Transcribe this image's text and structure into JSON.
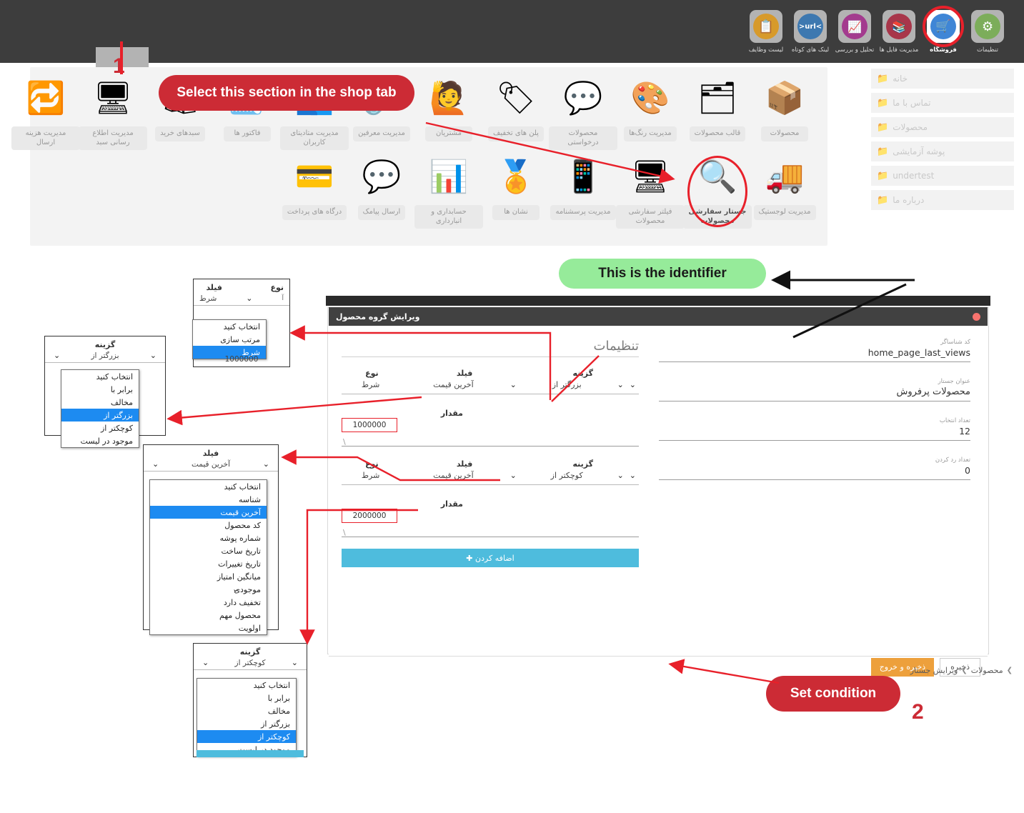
{
  "topbar": {
    "icons": [
      {
        "label": "تنظیمات",
        "name": "settings",
        "glyph": "⚙",
        "color": "#7cad5a",
        "active": false
      },
      {
        "label": "فروشگاه",
        "name": "shop",
        "glyph": "🛒",
        "color": "#3f86d6",
        "active": true,
        "highlighted": true
      },
      {
        "label": "مدیریت فایل ها",
        "name": "file-manager",
        "glyph": "📚",
        "color": "#a8364a",
        "active": false
      },
      {
        "label": "تحلیل و بررسی",
        "name": "analytics",
        "glyph": "📈",
        "color": "#a33b8e",
        "active": false
      },
      {
        "label": "لینک های کوتاه",
        "name": "short-links",
        "glyph": "url",
        "color": "#3d78b0",
        "active": false
      },
      {
        "label": "لیست وظایف",
        "name": "task-list",
        "glyph": "📋",
        "color": "#d79a2b",
        "active": false
      }
    ]
  },
  "icon_panel": {
    "items": [
      {
        "label": "محصولات",
        "art": "📦",
        "row": 1,
        "col": 1
      },
      {
        "label": "قالب محصولات",
        "art": "🗂",
        "row": 1,
        "col": 2
      },
      {
        "label": "مدیریت رنگ‌ها",
        "art": "🎨",
        "row": 1,
        "col": 3
      },
      {
        "label": "محصولات درخواستی",
        "art": "💬",
        "row": 1,
        "col": 4
      },
      {
        "label": "پلن های تخفیف",
        "art": "🏷",
        "row": 1,
        "col": 5
      },
      {
        "label": "مشتریان",
        "art": "🙋",
        "row": 1,
        "col": 6
      },
      {
        "label": "مدیریت معرفین",
        "art": "🔗",
        "row": 1,
        "col": 7
      },
      {
        "label": "مدیریت متادیتای کاربران",
        "art": "👥",
        "row": 1,
        "col": 8
      },
      {
        "label": "فاکتور ها",
        "art": "🧾",
        "row": 1,
        "col": 9
      },
      {
        "label": "سبدهای خرید",
        "art": "🛍",
        "row": 1,
        "col": 10
      },
      {
        "label": "مدیریت اطلاع رسانی سبد",
        "art": "🖥",
        "row": 1,
        "col": 11
      },
      {
        "label": "مدیریت هزینه ارسال",
        "art": "🔁",
        "row": 1,
        "col": 12
      },
      {
        "label": "مدیریت لوجستیک",
        "art": "🚚",
        "row": 2,
        "col": 1
      },
      {
        "label": "جستار سفارشی محصولات",
        "art": "🔍",
        "row": 2,
        "col": 2,
        "selected": true
      },
      {
        "label": "فیلتر سفارشی محصولات",
        "art": "🖥",
        "row": 2,
        "col": 3
      },
      {
        "label": "مدیریت پرسشنامه",
        "art": "📱",
        "row": 2,
        "col": 4
      },
      {
        "label": "نشان ها",
        "art": "🏅",
        "row": 2,
        "col": 5
      },
      {
        "label": "حسابداری و انبارداری",
        "art": "📊",
        "row": 2,
        "col": 6
      },
      {
        "label": "ارسال پیامک",
        "art": "💬",
        "row": 2,
        "col": 7
      },
      {
        "label": "درگاه های پرداخت",
        "art": "💳",
        "row": 2,
        "col": 8
      }
    ]
  },
  "folder_list": {
    "items": [
      {
        "label": "خانه"
      },
      {
        "label": "تماس با ما"
      },
      {
        "label": "محصولات"
      },
      {
        "label": "پوشه آزمایشی"
      },
      {
        "label": "undertest"
      },
      {
        "label": "درباره ما"
      }
    ]
  },
  "callouts": {
    "step1_banner": "Select this section in the shop tab",
    "step1_number": "1",
    "identifier_banner": "This is the identifier",
    "step2_banner": "Set condition",
    "step2_number": "2"
  },
  "window": {
    "title": "ویرایش گروه محصول",
    "fields": [
      {
        "label": "کد شناساگر",
        "value": "home_page_last_views",
        "ltr": true
      },
      {
        "label": "عنوان جستار",
        "value": "محصولات پرفروش",
        "ltr": false
      },
      {
        "label": "تعداد انتخاب",
        "value": "12",
        "ltr": true
      },
      {
        "label": "تعداد رد کردن",
        "value": "0",
        "ltr": true
      }
    ],
    "settings_title": "تنظیمات",
    "headers": {
      "type": "نوع",
      "field": "فیلد",
      "option": "گزینه",
      "value": "مقدار"
    },
    "conditions": [
      {
        "type": "شرط",
        "field": "آخرین قیمت",
        "option": "بزرگتر از",
        "value": "1000000"
      },
      {
        "type": "شرط",
        "field": "آخرین قیمت",
        "option": "کوچکتر از",
        "value": "2000000"
      }
    ],
    "add_button": "اضافه کردن ✚",
    "save_button": "ذخیره",
    "save_exit_button": "ذخیره و خروج"
  },
  "breadcrumb": {
    "items": [
      "محصولات",
      "ویرایش جستار"
    ],
    "separator": "❯"
  },
  "zoom_callouts": {
    "type_dropdown": {
      "header_type": "نوع",
      "header_field": "فیلد",
      "selected": "شرط",
      "peek": "آ",
      "options": [
        "انتخاب کنید",
        "مرتب سازی",
        "شرط"
      ],
      "selected_index": 2,
      "extra_value": "1000000"
    },
    "option_dropdown_top": {
      "header": "گزینه",
      "selected": "بزرگتر از",
      "options": [
        "انتخاب کنید",
        "برابر با",
        "مخالف",
        "بزرگتر از",
        "کوچکتر از",
        "موجود در لیست"
      ],
      "selected_index": 3
    },
    "field_dropdown": {
      "header": "فیلد",
      "selected": "آخرین قیمت",
      "options": [
        "انتخاب کنید",
        "شناسه",
        "آخرین قیمت",
        "کد محصول",
        "شماره پوشه",
        "تاریخ ساخت",
        "تاریخ تغییرات",
        "میانگین امتیاز",
        "موجودی",
        "تخفیف دارد",
        "محصول مهم",
        "اولویت"
      ],
      "selected_index": 2
    },
    "option_dropdown_bottom": {
      "header": "گزینه",
      "selected": "کوچکتر از",
      "options": [
        "انتخاب کنید",
        "برابر با",
        "مخالف",
        "بزرگتر از",
        "کوچکتر از",
        "موجود در لیست"
      ],
      "selected_index": 4
    }
  },
  "colors": {
    "topbar_bg": "#3d3d3d",
    "accent_red": "#cc2b35",
    "accent_green": "#96eb9a",
    "highlight_blue": "#1d8bf1",
    "add_button": "#4ebcdd",
    "save_exit": "#eda03c"
  }
}
